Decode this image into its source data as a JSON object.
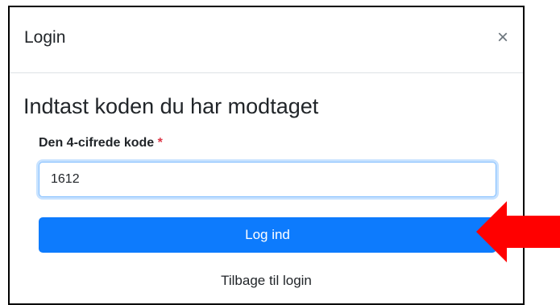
{
  "modal": {
    "title": "Login",
    "close_label": "×",
    "heading": "Indtast koden du har modtaget",
    "code_field": {
      "label": "Den 4-cifrede kode",
      "required_marker": "*",
      "value": "1612"
    },
    "submit_label": "Log ind",
    "back_link": "Tilbage til login"
  },
  "colors": {
    "primary_button": "#0d7bfd",
    "input_focus_border": "#80bdff",
    "required_marker": "#dc3545",
    "annotation_arrow": "#ff0000"
  },
  "annotation": {
    "icon": "red-arrow-left-icon"
  }
}
